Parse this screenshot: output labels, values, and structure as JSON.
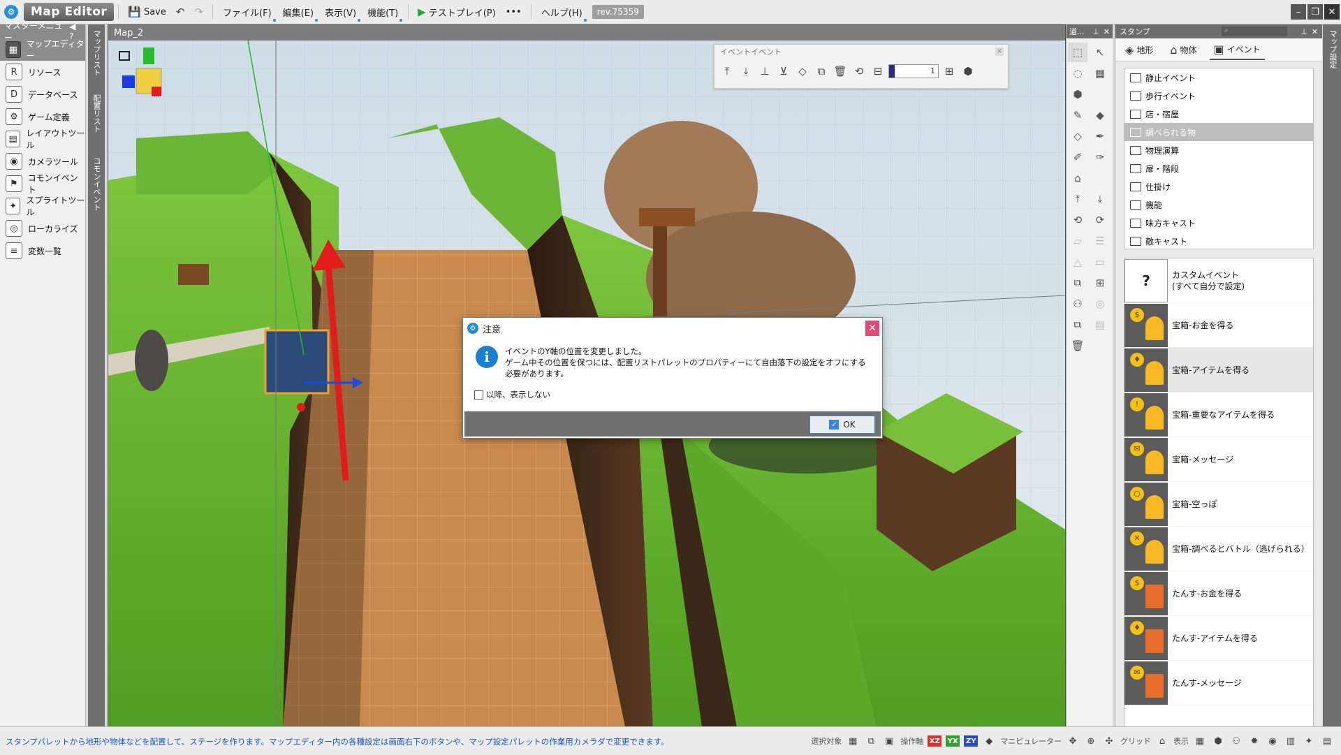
{
  "app": {
    "logo_glyph": "⚙",
    "title": "Map Editor"
  },
  "toolbar": {
    "save_label": "Save",
    "menus": [
      "ファイル(F)",
      "編集(E)",
      "表示(V)",
      "機能(T)"
    ],
    "testplay_label": "テストプレイ(P)",
    "more_label": "•••",
    "help_label": "ヘルプ(H)",
    "revision": "rev.75359"
  },
  "left_menu": {
    "header": "マスターメニュー",
    "items": [
      {
        "label": "マップエディター",
        "icon": "map-icon",
        "glyph": "▦"
      },
      {
        "label": "リソース",
        "icon": "resource-icon",
        "glyph": "R"
      },
      {
        "label": "データベース",
        "icon": "database-icon",
        "glyph": "D"
      },
      {
        "label": "ゲーム定義",
        "icon": "game-settings-icon",
        "glyph": "⚙"
      },
      {
        "label": "レイアウトツール",
        "icon": "layout-icon",
        "glyph": "▤"
      },
      {
        "label": "カメラツール",
        "icon": "camera-icon",
        "glyph": "◉"
      },
      {
        "label": "コモンイベント",
        "icon": "common-event-icon",
        "glyph": "⚑"
      },
      {
        "label": "スプライトツール",
        "icon": "sprite-icon",
        "glyph": "✦"
      },
      {
        "label": "ローカライズ",
        "icon": "localize-icon",
        "glyph": "◎"
      },
      {
        "label": "変数一覧",
        "icon": "variables-icon",
        "glyph": "≡"
      }
    ]
  },
  "vtabs_left": [
    "マップリスト",
    "配置リスト",
    "コモンイベント"
  ],
  "viewport": {
    "tab_title": "Map_2"
  },
  "event_toolbar": {
    "title": "イベントイベント",
    "slider_value": "1",
    "slider_fraction": 0.12
  },
  "dialog": {
    "title": "注意",
    "line1": "イベントのY軸の位置を変更しました。",
    "line2": "ゲーム中その位置を保つには、配置リストパレットのプロパティーにて自由落下の設定をオフにする必要があります。",
    "checkbox_label": "以降、表示しない",
    "ok_label": "OK"
  },
  "tool_palette": {
    "header": "道..."
  },
  "stamp_panel": {
    "header": "スタンプ",
    "tabs": [
      {
        "label": "地形",
        "icon": "terrain-icon",
        "glyph": "◈"
      },
      {
        "label": "物体",
        "icon": "object-icon",
        "glyph": "⌂"
      },
      {
        "label": "イベント",
        "icon": "event-icon",
        "glyph": "▣"
      }
    ],
    "folders": [
      "静止イベント",
      "歩行イベント",
      "店・宿屋",
      "調べられる物",
      "物理演算",
      "扉・階段",
      "仕掛け",
      "機能",
      "味方キャスト",
      "敵キャスト"
    ],
    "selected_folder": 3,
    "items": [
      {
        "label": "カスタムイベント\n(すべて自分で設定)",
        "kind": "custom",
        "badge": "?"
      },
      {
        "label": "宝箱-お金を得る",
        "kind": "chest",
        "badge": "$"
      },
      {
        "label": "宝箱-アイテムを得る",
        "kind": "chest",
        "badge": "♦"
      },
      {
        "label": "宝箱-重要なアイテムを得る",
        "kind": "chest",
        "badge": "!"
      },
      {
        "label": "宝箱-メッセージ",
        "kind": "chest",
        "badge": "✉"
      },
      {
        "label": "宝箱-空っぽ",
        "kind": "chest",
        "badge": "○"
      },
      {
        "label": "宝箱-調べるとバトル（逃げられる）",
        "kind": "chest",
        "badge": "✕"
      },
      {
        "label": "たんす-お金を得る",
        "kind": "dresser",
        "badge": "$"
      },
      {
        "label": "たんす-アイテムを得る",
        "kind": "dresser",
        "badge": "♦"
      },
      {
        "label": "たんす-メッセージ",
        "kind": "dresser",
        "badge": "✉"
      }
    ],
    "selected_item": 2
  },
  "vtabs_right": [
    "マップ設定"
  ],
  "statusbar": {
    "text": "スタンプパレットから地形や物体などを配置して、ステージを作ります。マップエディター内の各種設定は画面右下のボタンや、マップ設定パレットの作業用カメラダで変更できます。",
    "select_label": "選択対象",
    "axis_label": "操作軸",
    "axes": [
      "XZ",
      "YX",
      "ZY"
    ],
    "manip_label": "マニピュレーター",
    "grid_label": "グリッド",
    "display_label": "表示"
  },
  "colors": {
    "accent": "#1b8fd8",
    "close": "#e04c78",
    "grass": "#5fae2a",
    "path": "#c98a4e",
    "cliff": "#3b2818",
    "sky": "#d9e6ef"
  }
}
